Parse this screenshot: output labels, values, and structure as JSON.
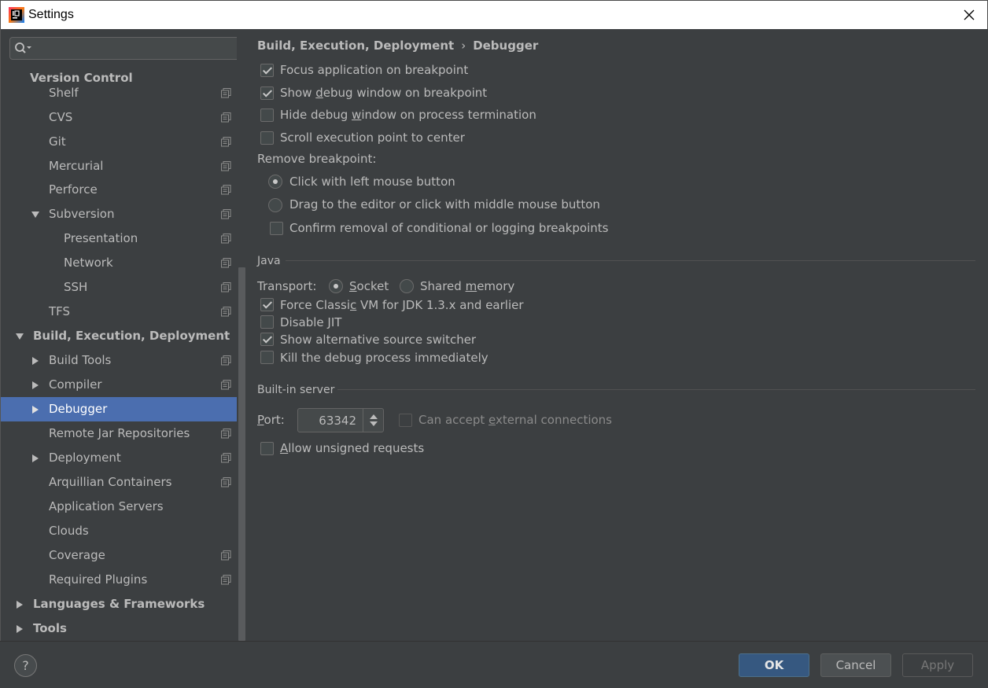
{
  "window": {
    "title": "Settings"
  },
  "search": {
    "placeholder": ""
  },
  "sidebar": {
    "items": [
      {
        "label": "Version Control",
        "bold": true
      },
      {
        "label": "Shelf"
      },
      {
        "label": "CVS"
      },
      {
        "label": "Git"
      },
      {
        "label": "Mercurial"
      },
      {
        "label": "Perforce"
      },
      {
        "label": "Subversion",
        "expanded": true
      },
      {
        "label": "Presentation"
      },
      {
        "label": "Network"
      },
      {
        "label": "SSH"
      },
      {
        "label": "TFS"
      },
      {
        "label": "Build, Execution, Deployment",
        "bold": true,
        "expanded": true
      },
      {
        "label": "Build Tools",
        "collapsed": true
      },
      {
        "label": "Compiler",
        "collapsed": true
      },
      {
        "label": "Debugger",
        "collapsed": true,
        "selected": true
      },
      {
        "label": "Remote Jar Repositories"
      },
      {
        "label": "Deployment",
        "collapsed": true
      },
      {
        "label": "Arquillian Containers"
      },
      {
        "label": "Application Servers"
      },
      {
        "label": "Clouds"
      },
      {
        "label": "Coverage"
      },
      {
        "label": "Required Plugins"
      },
      {
        "label": "Languages & Frameworks",
        "bold": true,
        "collapsed": true
      },
      {
        "label": "Tools",
        "bold": true,
        "collapsed": true
      }
    ]
  },
  "breadcrumb": {
    "parent": "Build, Execution, Deployment",
    "separator": "›",
    "current": "Debugger"
  },
  "options": {
    "focus_app": {
      "label": "Focus application on breakpoint",
      "checked": true
    },
    "show_debug_pre": "Show ",
    "show_debug_u": "d",
    "show_debug_post": "ebug window on breakpoint",
    "hide_debug_pre": "Hide debug ",
    "hide_debug_u": "w",
    "hide_debug_post": "indow on process termination",
    "scroll_exec": {
      "label": "Scroll execution point to center",
      "checked": false
    }
  },
  "remove_breakpoint": {
    "label": "Remove breakpoint:",
    "click_left": "Click with left mouse button",
    "drag_editor": "Drag to the editor or click with middle mouse button",
    "confirm_removal": "Confirm removal of conditional or logging breakpoints"
  },
  "java": {
    "title": "Java",
    "transport_label": "Transport:",
    "socket_u": "S",
    "socket_rest": "ocket",
    "shared_pre": "Shared ",
    "shared_u": "m",
    "shared_post": "emory",
    "force_classic_pre": "Force Classi",
    "force_classic_u": "c",
    "force_classic_post": " VM for JDK 1.3.x and earlier",
    "disable_jit": "Disable JIT",
    "show_alt_source": "Show alternative source switcher",
    "kill_debug": "Kill the debug process immediately"
  },
  "builtin": {
    "title": "Built-in server",
    "port_u": "P",
    "port_rest": "ort:",
    "port_value": "63342",
    "accept_pre": "Can accept ",
    "accept_u": "e",
    "accept_post": "xternal connections",
    "allow_u": "A",
    "allow_rest": "llow unsigned requests"
  },
  "footer": {
    "help": "?",
    "ok": "OK",
    "cancel": "Cancel",
    "apply": "Apply"
  }
}
